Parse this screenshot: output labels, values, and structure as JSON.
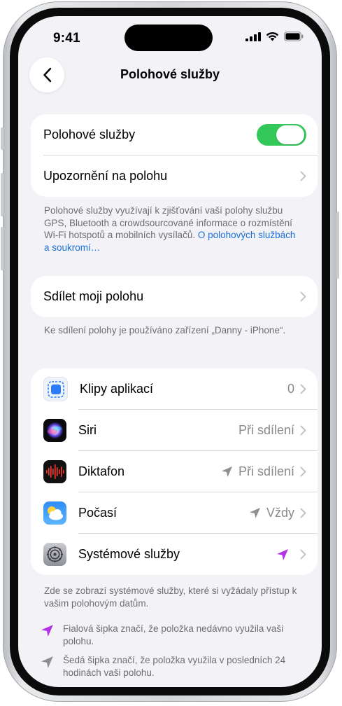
{
  "status": {
    "time": "9:41"
  },
  "nav": {
    "title": "Polohové služby"
  },
  "group1": {
    "location_services_label": "Polohové služby",
    "location_services_on": true,
    "location_alerts_label": "Upozornění na polohu"
  },
  "footnote1": {
    "text": "Polohové služby využívají k zjišťování vaší polohy službu GPS, Bluetooth a crowdsourcované informace o rozmístění Wi-Fi hotspotů a mobilních vysílačů.",
    "link": "O polohových službách a soukromí…"
  },
  "group2": {
    "share_label": "Sdílet moji polohu"
  },
  "footnote2": {
    "text": "Ke sdílení polohy je používáno zařízení „Danny - iPhone“."
  },
  "apps": [
    {
      "name": "Klipy aplikací",
      "value": "0",
      "arrow": "none",
      "icon": "app-clips-icon"
    },
    {
      "name": "Siri",
      "value": "Při sdílení",
      "arrow": "none",
      "icon": "siri-icon"
    },
    {
      "name": "Diktafon",
      "value": "Při sdílení",
      "arrow": "gray",
      "icon": "voice-memos-icon"
    },
    {
      "name": "Počasí",
      "value": "Vždy",
      "arrow": "gray",
      "icon": "weather-icon"
    },
    {
      "name": "Systémové služby",
      "value": "",
      "arrow": "purple",
      "icon": "settings-gear-icon"
    }
  ],
  "footnote3": {
    "text": "Zde se zobrazí systémové služby, které si vyžádaly přístup k vašim polohovým datům."
  },
  "legend": {
    "purple": "Fialová šipka značí, že položka nedávno využila vaši polohu.",
    "gray": "Šedá šipka značí, že položka využila v posledních 24 hodinách vaši polohu."
  },
  "colors": {
    "toggle_on": "#34c759",
    "link": "#1b6fd9",
    "arrow_purple": "#b332e6",
    "arrow_gray": "#8e8e93"
  }
}
